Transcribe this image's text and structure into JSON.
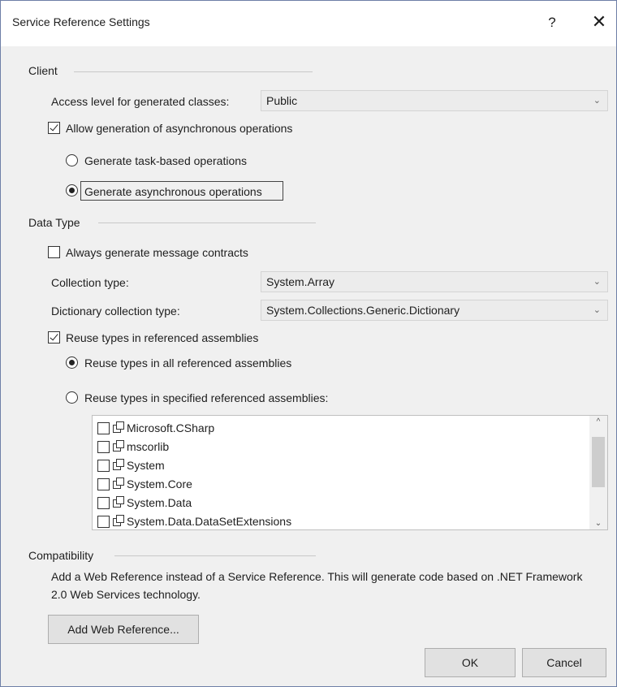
{
  "window": {
    "title": "Service Reference Settings",
    "help_glyph": "?",
    "close_glyph": "✕"
  },
  "client": {
    "group_title": "Client",
    "access_level_label": "Access level for generated classes:",
    "access_level_value": "Public",
    "allow_async_label": "Allow generation of asynchronous operations",
    "allow_async_checked": true,
    "task_based_label": "Generate task-based operations",
    "async_ops_label": "Generate asynchronous operations",
    "selected_radio": "async_ops"
  },
  "data_type": {
    "group_title": "Data Type",
    "always_generate_label": "Always generate message contracts",
    "always_generate_checked": false,
    "collection_type_label": "Collection type:",
    "collection_type_value": "System.Array",
    "dictionary_type_label": "Dictionary collection type:",
    "dictionary_type_value": "System.Collections.Generic.Dictionary",
    "reuse_types_label": "Reuse types in referenced assemblies",
    "reuse_types_checked": true,
    "reuse_all_label": "Reuse types in all referenced assemblies",
    "reuse_specified_label": "Reuse types in specified referenced assemblies:",
    "selected_reuse": "all",
    "assemblies": [
      "Microsoft.CSharp",
      "mscorlib",
      "System",
      "System.Core",
      "System.Data",
      "System.Data.DataSetExtensions"
    ]
  },
  "compatibility": {
    "group_title": "Compatibility",
    "description": "Add a Web Reference instead of a Service Reference. This will generate code based on .NET Framework 2.0 Web Services technology.",
    "add_web_reference_label": "Add Web Reference..."
  },
  "footer": {
    "ok_label": "OK",
    "cancel_label": "Cancel"
  },
  "glyphs": {
    "chevron_down": "⌄",
    "scroll_up": "^",
    "scroll_down": "⌄"
  }
}
